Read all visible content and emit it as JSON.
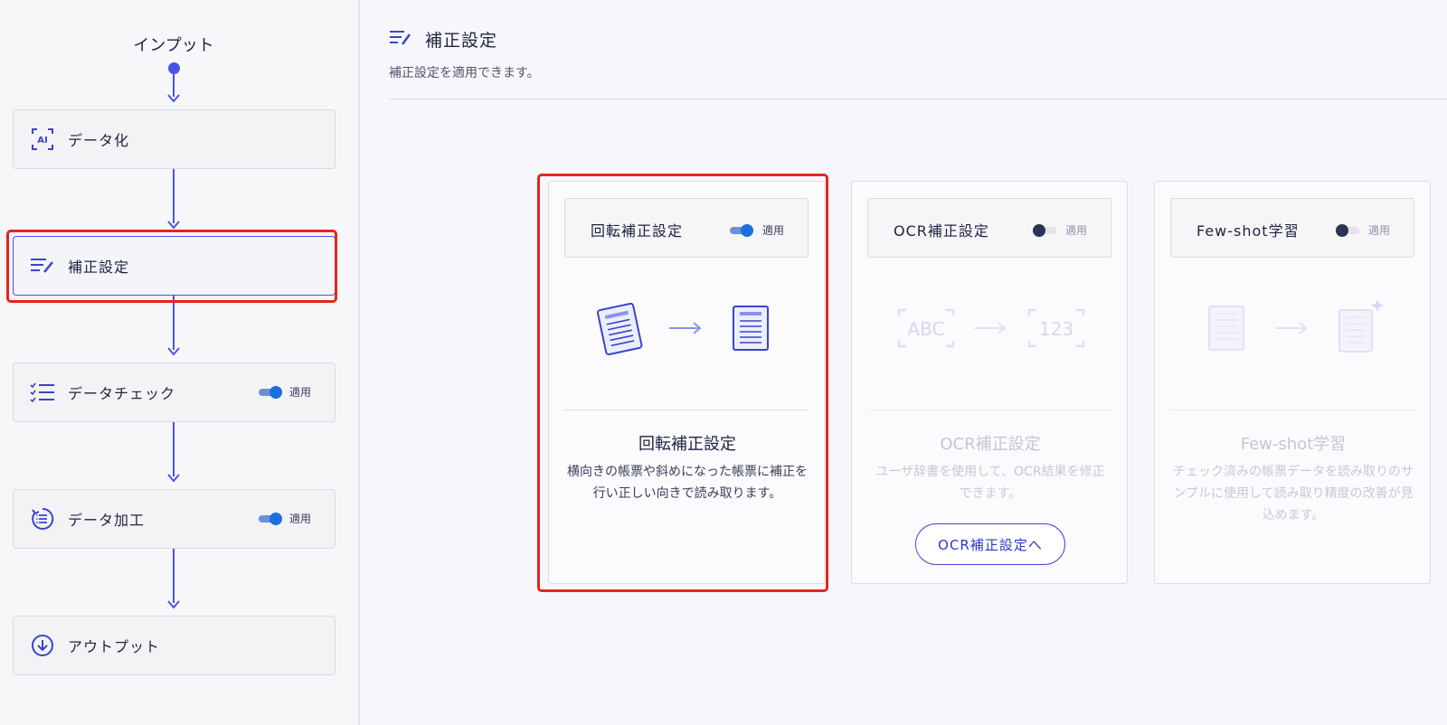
{
  "flow": {
    "title": "インプット",
    "steps": [
      {
        "label": "データ化",
        "icon": "ai-scan-icon"
      },
      {
        "label": "補正設定",
        "icon": "list-edit-icon",
        "active": true
      },
      {
        "label": "データチェック",
        "icon": "checklist-icon",
        "toggle_label": "適用",
        "toggle_on": true
      },
      {
        "label": "データ加工",
        "icon": "process-list-icon",
        "toggle_label": "適用",
        "toggle_on": true
      },
      {
        "label": "アウトプット",
        "icon": "download-circle-icon"
      }
    ]
  },
  "main": {
    "title": "補正設定",
    "subtitle": "補正設定を適用できます。",
    "cards": [
      {
        "header": "回転補正設定",
        "toggle_label": "適用",
        "toggle_on": true,
        "title": "回転補正設定",
        "description": "横向きの帳票や斜めになった帳票に補正を行い正しい向きで読み取ります。",
        "illustration": "rotate-document-illustration"
      },
      {
        "header": "OCR補正設定",
        "toggle_label": "適用",
        "toggle_on": false,
        "title": "OCR補正設定",
        "description": "ユーザ辞書を使用して、OCR結果を修正できます。",
        "illustration": "abc-to-123-illustration",
        "illus_left": "ABC",
        "illus_right": "123",
        "button": "OCR補正設定へ"
      },
      {
        "header": "Few-shot学習",
        "toggle_label": "適用",
        "toggle_on": false,
        "title": "Few-shot学習",
        "description": "チェック済みの帳票データを読み取りのサンプルに使用して読み取り精度の改善が見込めます。",
        "illustration": "document-sparkle-illustration"
      }
    ]
  },
  "colors": {
    "accent": "#4a52e8",
    "highlight": "#e5251b",
    "toggle_on": "#1d6fe0",
    "toggle_off_knob": "#2d3352"
  }
}
